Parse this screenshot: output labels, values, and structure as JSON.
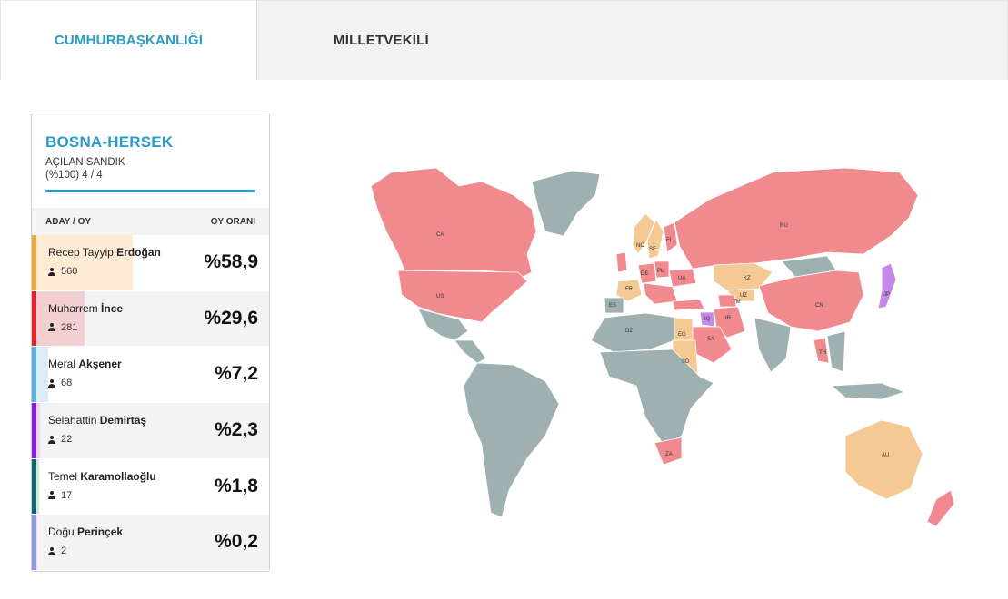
{
  "tabs": [
    {
      "label": "CUMHURBAŞKANLIĞI",
      "active": true
    },
    {
      "label": "MİLLETVEKİLİ",
      "active": false
    }
  ],
  "panel": {
    "region": "BOSNA-HERSEK",
    "opened_label": "AÇILAN SANDIK",
    "opened_value": "(%100) 4 / 4",
    "opened_percent": 100,
    "col_candidate": "ADAY / OY",
    "col_rate": "OY ORANI",
    "candidates": [
      {
        "first": "Recep Tayyip",
        "last": "Erdoğan",
        "votes": "560",
        "pct": "%58,9",
        "share": 58.9,
        "color": "#f0a83c",
        "fill": "#fdebd6"
      },
      {
        "first": "Muharrem",
        "last": "İnce",
        "votes": "281",
        "pct": "%29,6",
        "share": 29.6,
        "color": "#e8232b",
        "fill": "#f4cfd2"
      },
      {
        "first": "Meral",
        "last": "Akşener",
        "votes": "68",
        "pct": "%7,2",
        "share": 7.2,
        "color": "#5aaee0",
        "fill": "#dbedf8"
      },
      {
        "first": "Selahattin",
        "last": "Demirtaş",
        "votes": "22",
        "pct": "%2,3",
        "share": 2.3,
        "color": "#8b1fe0",
        "fill": "#ead5f8"
      },
      {
        "first": "Temel",
        "last": "Karamollaoğlu",
        "votes": "17",
        "pct": "%1,8",
        "share": 1.8,
        "color": "#0e6a6a",
        "fill": "#d3e4e4"
      },
      {
        "first": "Doğu",
        "last": "Perinçek",
        "votes": "2",
        "pct": "%0,2",
        "share": 0.2,
        "color": "#8e97e0",
        "fill": "#e3e6f8"
      }
    ]
  },
  "map": {
    "colors": {
      "erdogan": "#f5c993",
      "ince": "#f08a8f",
      "demirtas": "#c58ae8",
      "none": "#9fb0b0",
      "border": "#ffffff"
    },
    "labels": [
      "CA",
      "US",
      "RU",
      "CN",
      "KZ",
      "UZ",
      "TM",
      "IR",
      "IQ",
      "SA",
      "EG",
      "SD",
      "DZ",
      "ES",
      "FR",
      "DE",
      "PL",
      "UA",
      "NO",
      "SE",
      "FI",
      "JP",
      "TH",
      "ZA",
      "AU"
    ]
  }
}
